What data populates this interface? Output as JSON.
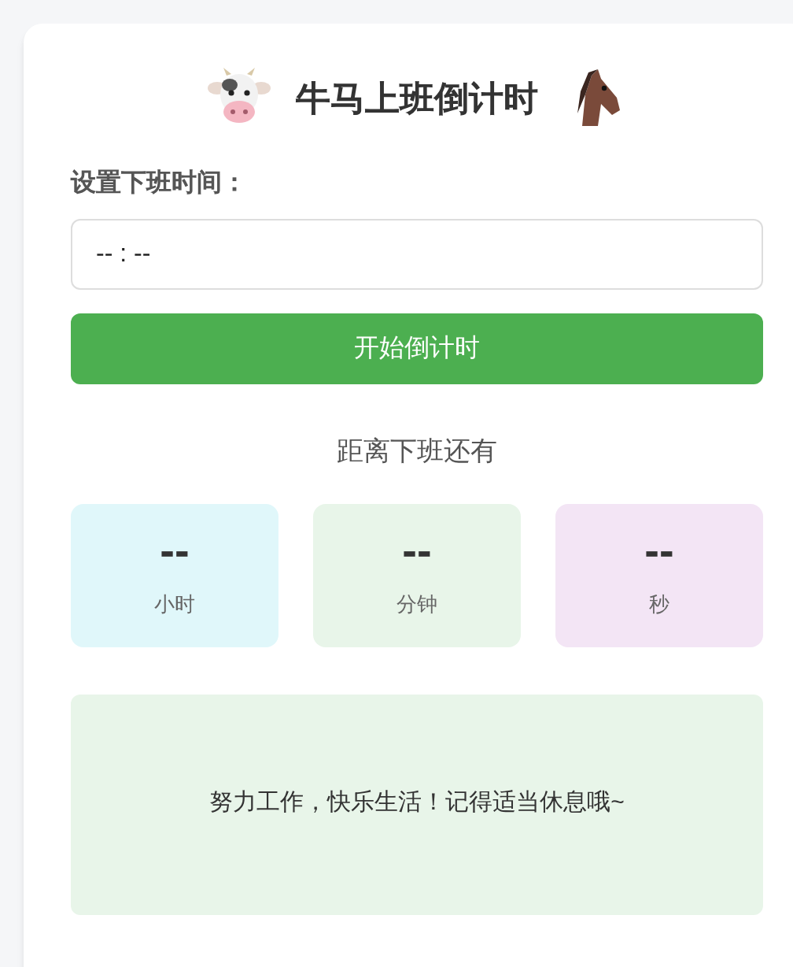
{
  "title": "牛马上班倒计时",
  "time_setting": {
    "label": "设置下班时间：",
    "value": "-- : --"
  },
  "start_button": "开始倒计时",
  "countdown_heading": "距离下班还有",
  "countdown": [
    {
      "value": "--",
      "unit": "小时",
      "color": "#e0f7fa"
    },
    {
      "value": "--",
      "unit": "分钟",
      "color": "#e8f5e9"
    },
    {
      "value": "--",
      "unit": "秒",
      "color": "#f3e5f5"
    }
  ],
  "message": "努力工作，快乐生活！记得适当休息哦~"
}
